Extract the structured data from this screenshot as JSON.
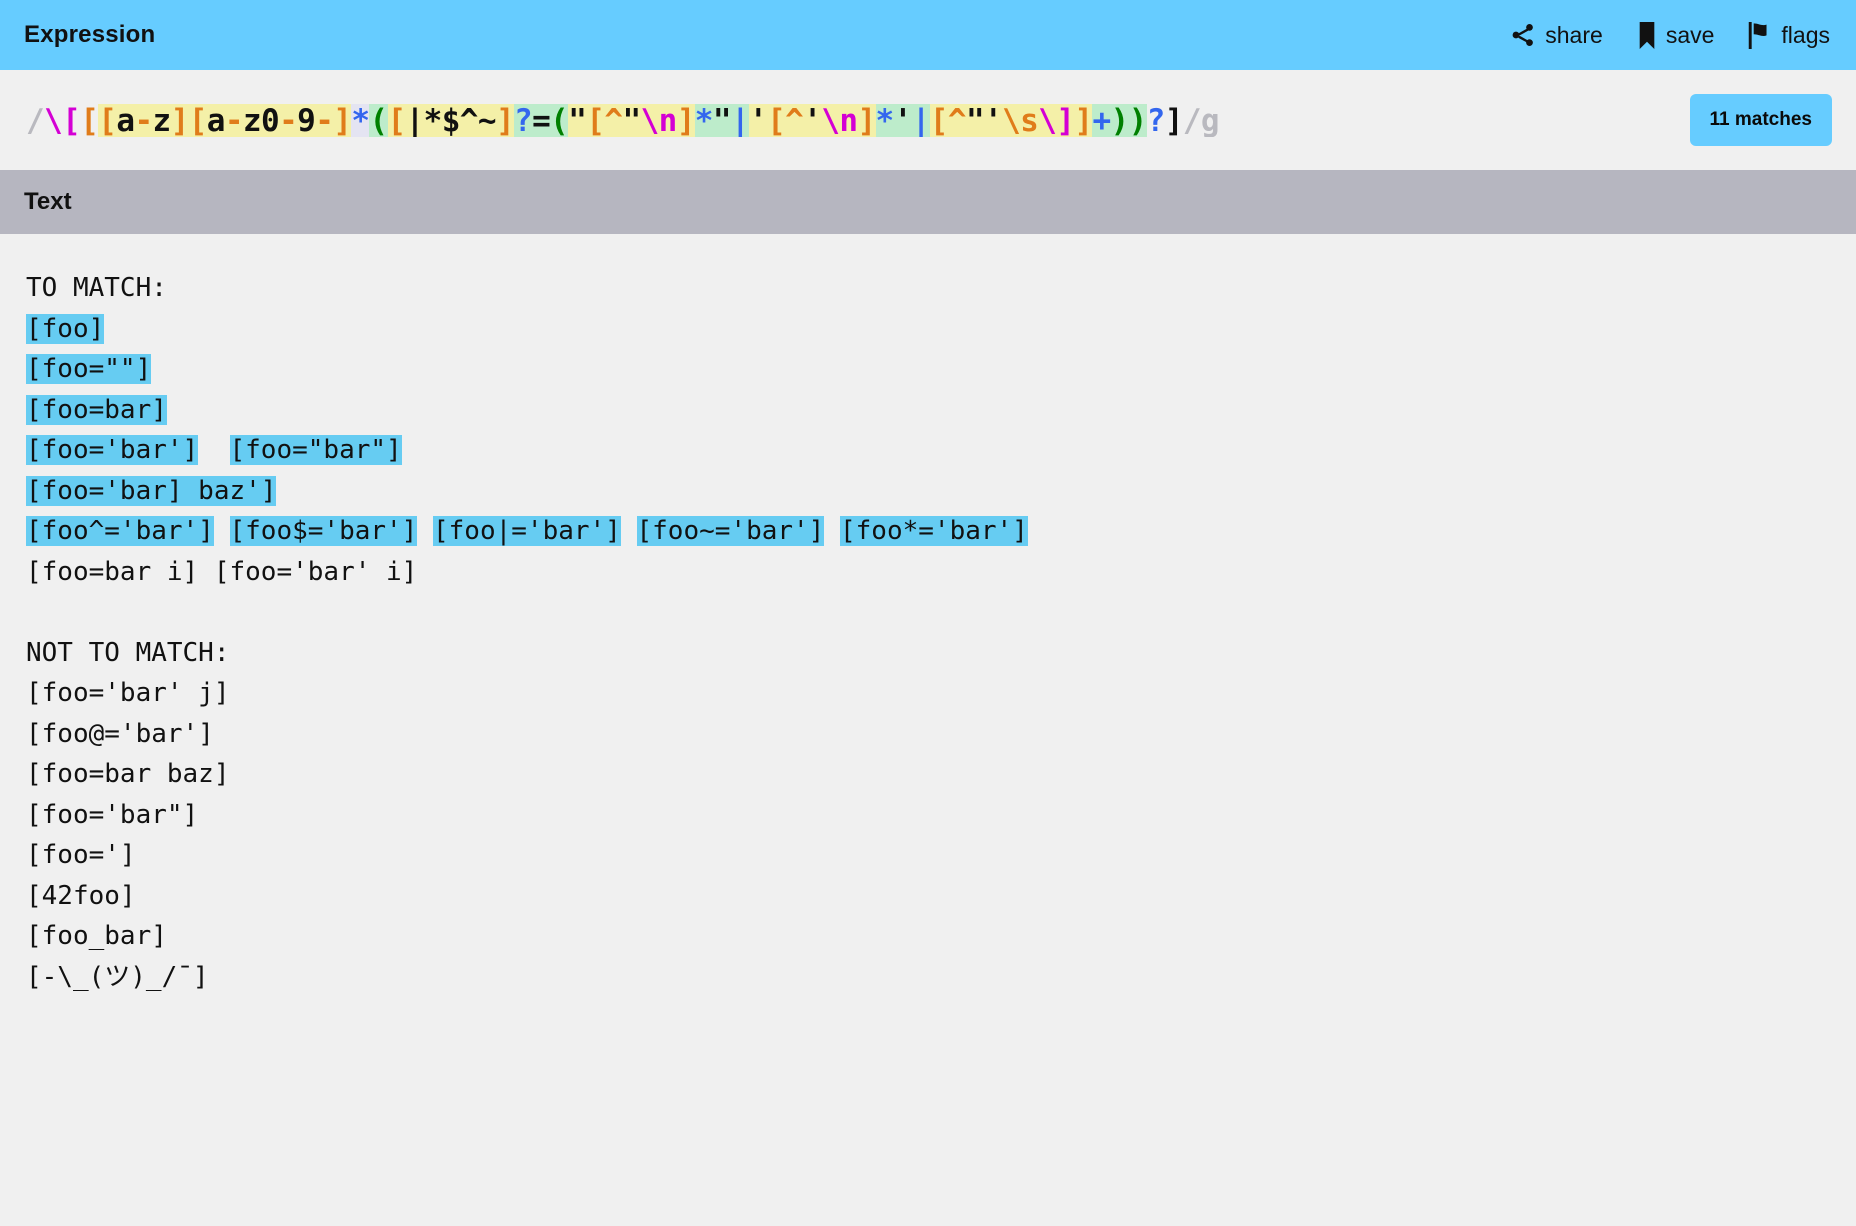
{
  "header": {
    "title": "Expression",
    "actions": [
      {
        "label": "share",
        "icon": "share-icon"
      },
      {
        "label": "save",
        "icon": "bookmark-icon"
      },
      {
        "label": "flags",
        "icon": "flag-icon"
      }
    ]
  },
  "expression": {
    "raw": "/\\[[a-z][a-z0-9-]*([|*$^~]?=(\"[^\"\\n]*\"|'[^'\\n]*'|[^\"'\\s\\]]+))?]/g",
    "pattern": "\\[[a-z][a-z0-9-]*([|*$^~]?=(\"[^\"\\n]*\"|'[^'\\n]*'|[^\"'\\s\\]]+))?]",
    "flags": "g",
    "delimiter": "/",
    "match_count_label": "11 matches",
    "colors": {
      "delimiter": "#b9b9bf",
      "escape": "#d400d4",
      "charclass_bracket": "#e07c1a",
      "literal": "#111111",
      "quantifier": "#3366ee",
      "group": "#008000",
      "charclass_bg": "#f4f0a8",
      "group_bg": "#bdeccb",
      "quantifier_bg": "#e4e4f2",
      "highlight": "#66ccf2",
      "accent": "#66ccff",
      "text_header_bg": "#b6b6c0",
      "page_bg": "#f0f0f0"
    },
    "tokens": [
      {
        "t": "/",
        "c": "delimiter",
        "bg": "none"
      },
      {
        "t": "\\[",
        "c": "escape",
        "bg": "none"
      },
      {
        "t": "[",
        "c": "charclass_bracket",
        "bg": "none"
      },
      {
        "t": "[",
        "c": "charclass_bracket",
        "bg": "charclass"
      },
      {
        "t": "a",
        "c": "literal",
        "bg": "charclass"
      },
      {
        "t": "-",
        "c": "charclass_bracket",
        "bg": "charclass"
      },
      {
        "t": "z",
        "c": "literal",
        "bg": "charclass"
      },
      {
        "t": "]",
        "c": "charclass_bracket",
        "bg": "charclass"
      },
      {
        "t": "[",
        "c": "charclass_bracket",
        "bg": "charclass"
      },
      {
        "t": "a",
        "c": "literal",
        "bg": "charclass"
      },
      {
        "t": "-",
        "c": "charclass_bracket",
        "bg": "charclass"
      },
      {
        "t": "z0",
        "c": "literal",
        "bg": "charclass"
      },
      {
        "t": "-",
        "c": "charclass_bracket",
        "bg": "charclass"
      },
      {
        "t": "9",
        "c": "literal",
        "bg": "charclass"
      },
      {
        "t": "-",
        "c": "charclass_bracket",
        "bg": "charclass"
      },
      {
        "t": "]",
        "c": "charclass_bracket",
        "bg": "charclass"
      },
      {
        "t": "*",
        "c": "quantifier",
        "bg": "quantifier"
      },
      {
        "t": "(",
        "c": "group",
        "bg": "group"
      },
      {
        "t": "[",
        "c": "charclass_bracket",
        "bg": "charclass"
      },
      {
        "t": "|*$^~",
        "c": "literal",
        "bg": "charclass"
      },
      {
        "t": "]",
        "c": "charclass_bracket",
        "bg": "charclass"
      },
      {
        "t": "?",
        "c": "quantifier",
        "bg": "group"
      },
      {
        "t": "=",
        "c": "literal",
        "bg": "group"
      },
      {
        "t": "(",
        "c": "group",
        "bg": "group"
      },
      {
        "t": "\"",
        "c": "literal",
        "bg": "charclass"
      },
      {
        "t": "[",
        "c": "charclass_bracket",
        "bg": "charclass"
      },
      {
        "t": "^",
        "c": "charclass_bracket",
        "bg": "charclass"
      },
      {
        "t": "\"",
        "c": "literal",
        "bg": "charclass"
      },
      {
        "t": "\\n",
        "c": "escape",
        "bg": "charclass"
      },
      {
        "t": "]",
        "c": "charclass_bracket",
        "bg": "charclass"
      },
      {
        "t": "*",
        "c": "quantifier",
        "bg": "group"
      },
      {
        "t": "\"",
        "c": "literal",
        "bg": "group"
      },
      {
        "t": "|",
        "c": "quantifier",
        "bg": "group"
      },
      {
        "t": "'",
        "c": "literal",
        "bg": "charclass"
      },
      {
        "t": "[",
        "c": "charclass_bracket",
        "bg": "charclass"
      },
      {
        "t": "^",
        "c": "charclass_bracket",
        "bg": "charclass"
      },
      {
        "t": "'",
        "c": "literal",
        "bg": "charclass"
      },
      {
        "t": "\\n",
        "c": "escape",
        "bg": "charclass"
      },
      {
        "t": "]",
        "c": "charclass_bracket",
        "bg": "charclass"
      },
      {
        "t": "*",
        "c": "quantifier",
        "bg": "group"
      },
      {
        "t": "'",
        "c": "literal",
        "bg": "group"
      },
      {
        "t": "|",
        "c": "quantifier",
        "bg": "group"
      },
      {
        "t": "[",
        "c": "charclass_bracket",
        "bg": "charclass"
      },
      {
        "t": "^",
        "c": "charclass_bracket",
        "bg": "charclass"
      },
      {
        "t": "\"'",
        "c": "literal",
        "bg": "charclass"
      },
      {
        "t": "\\s",
        "c": "charclass_bracket",
        "bg": "charclass"
      },
      {
        "t": "\\]",
        "c": "escape",
        "bg": "charclass"
      },
      {
        "t": "]",
        "c": "charclass_bracket",
        "bg": "charclass"
      },
      {
        "t": "+",
        "c": "quantifier",
        "bg": "group"
      },
      {
        "t": ")",
        "c": "group",
        "bg": "group"
      },
      {
        "t": ")",
        "c": "group",
        "bg": "group"
      },
      {
        "t": "?",
        "c": "quantifier",
        "bg": "none"
      },
      {
        "t": "]",
        "c": "literal",
        "bg": "none"
      },
      {
        "t": "/g",
        "c": "delimiter",
        "bg": "none"
      }
    ]
  },
  "text_section": {
    "title": "Text",
    "lines": [
      {
        "segments": [
          {
            "text": "TO MATCH:",
            "match": false
          }
        ]
      },
      {
        "segments": [
          {
            "text": "[foo]",
            "match": true
          }
        ]
      },
      {
        "segments": [
          {
            "text": "[foo=\"\"]",
            "match": true
          }
        ]
      },
      {
        "segments": [
          {
            "text": "[foo=bar]",
            "match": true
          }
        ]
      },
      {
        "segments": [
          {
            "text": "[foo='bar']",
            "match": true
          },
          {
            "text": "  ",
            "match": false
          },
          {
            "text": "[foo=\"bar\"]",
            "match": true
          }
        ]
      },
      {
        "segments": [
          {
            "text": "[foo='bar] baz']",
            "match": true
          }
        ]
      },
      {
        "segments": [
          {
            "text": "[foo^='bar']",
            "match": true
          },
          {
            "text": " ",
            "match": false
          },
          {
            "text": "[foo$='bar']",
            "match": true
          },
          {
            "text": " ",
            "match": false
          },
          {
            "text": "[foo|='bar']",
            "match": true
          },
          {
            "text": " ",
            "match": false
          },
          {
            "text": "[foo~='bar']",
            "match": true
          },
          {
            "text": " ",
            "match": false
          },
          {
            "text": "[foo*='bar']",
            "match": true
          }
        ]
      },
      {
        "segments": [
          {
            "text": "[foo=bar i] [foo='bar' i]",
            "match": false
          }
        ]
      },
      {
        "segments": [
          {
            "text": "",
            "match": false
          }
        ]
      },
      {
        "segments": [
          {
            "text": "NOT TO MATCH:",
            "match": false
          }
        ]
      },
      {
        "segments": [
          {
            "text": "[foo='bar' j]",
            "match": false
          }
        ]
      },
      {
        "segments": [
          {
            "text": "[foo@='bar']",
            "match": false
          }
        ]
      },
      {
        "segments": [
          {
            "text": "[foo=bar baz]",
            "match": false
          }
        ]
      },
      {
        "segments": [
          {
            "text": "[foo='bar\"]",
            "match": false
          }
        ]
      },
      {
        "segments": [
          {
            "text": "[foo=']",
            "match": false
          }
        ]
      },
      {
        "segments": [
          {
            "text": "[42foo]",
            "match": false
          }
        ]
      },
      {
        "segments": [
          {
            "text": "[foo_bar]",
            "match": false
          }
        ]
      },
      {
        "segments": [
          {
            "text": "[-\\_(ツ)_/¯]",
            "match": false
          }
        ]
      }
    ]
  }
}
